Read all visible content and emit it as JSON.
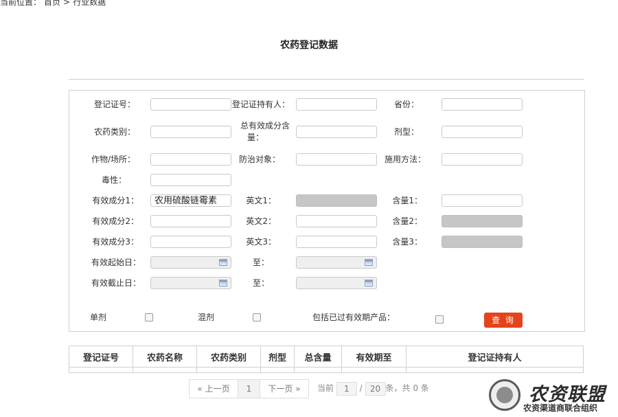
{
  "breadcrumb": {
    "prefix": "当前位置：",
    "home": "首页",
    "sep": ">",
    "current": "行业数据"
  },
  "page_title": "农药登记数据",
  "form": {
    "labels": {
      "reg_no": "登记证号：",
      "reg_holder": "登记证持有人：",
      "province": "省份：",
      "pesticide_type": "农药类别：",
      "total_content_1": "总有效成分含",
      "total_content_2": "量：",
      "formulation": "剂型：",
      "crop": "作物/场所：",
      "target": "防治对象：",
      "method": "施用方法：",
      "toxicity": "毒性：",
      "ingredient1": "有效成分1：",
      "english1": "英文1：",
      "content1": "含量1：",
      "ingredient2": "有效成分2：",
      "english2": "英文2：",
      "content2": "含量2：",
      "ingredient3": "有效成分3：",
      "english3": "英文3：",
      "content3": "含量3：",
      "valid_start": "有效起始日：",
      "valid_end": "有效截止日：",
      "to": "至：",
      "single": "单剂",
      "mixed": "混剂",
      "include_expired": "包括已过有效期产品："
    },
    "values": {
      "ingredient1": "农用硫酸链霉素"
    },
    "search_button": "查 询"
  },
  "table": {
    "headers": [
      "登记证号",
      "农药名称",
      "农药类别",
      "剂型",
      "总含量",
      "有效期至",
      "登记证持有人"
    ]
  },
  "pager": {
    "prev": "« 上一页",
    "page": "1",
    "next": "下一页 »",
    "current_label": "当前",
    "current_value": "1",
    "slash": "/",
    "page_size": "20",
    "suffix": "条，共 0 条"
  },
  "watermark": {
    "name": "农资联盟",
    "slogan": "农资渠道商联合组织"
  },
  "colors": {
    "accent": "#e5431b",
    "disabled": "#c6c6c6",
    "border": "#cfcfcf"
  }
}
